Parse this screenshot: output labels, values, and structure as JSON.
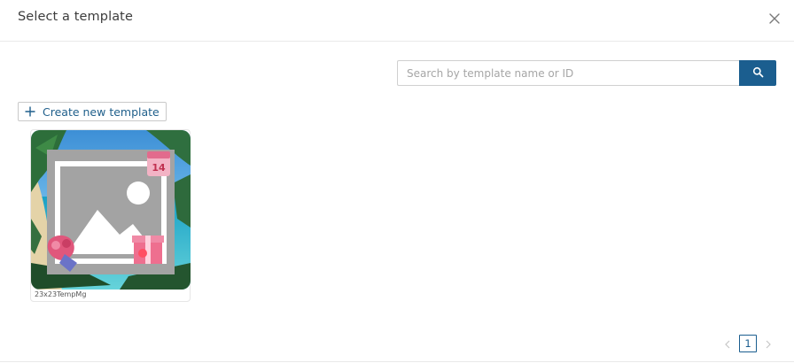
{
  "dialog": {
    "title": "Select a template"
  },
  "search": {
    "placeholder": "Search by template name or ID",
    "value": ""
  },
  "actions": {
    "create_label": "Create new template"
  },
  "templates": [
    {
      "name": "23x23TempMg"
    }
  ],
  "pagination": {
    "current_page": "1"
  },
  "colors": {
    "primary": "#1b5e8f",
    "border": "#d0d0d0"
  },
  "icons": {
    "close": "close-icon",
    "search": "search-icon",
    "plus": "plus-icon",
    "prev": "chevron-left-icon",
    "next": "chevron-right-icon"
  }
}
